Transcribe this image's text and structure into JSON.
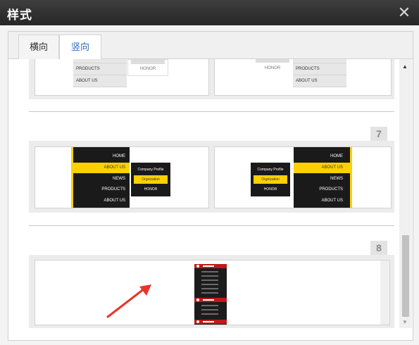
{
  "dialog": {
    "title": "样式",
    "close_icon": "close-icon"
  },
  "tabs": [
    {
      "label": "横向",
      "active": false
    },
    {
      "label": "竖向",
      "active": true
    }
  ],
  "sections": [
    {
      "number": "",
      "left_card": {
        "menu_items": [
          "PRODUCTS",
          "ABOUT US"
        ],
        "submenu_items": [
          "HONOR"
        ]
      },
      "right_card": {
        "menu_items": [
          "PRODUCTS",
          "ABOUT US"
        ],
        "submenu_items": [
          "HONOR"
        ]
      }
    },
    {
      "number": "7",
      "left_card": {
        "menu_items": [
          "HOME",
          "ABOUT US",
          "NEWS",
          "PRODUCTS",
          "ABOUT US"
        ],
        "active_index": 1,
        "submenu_items": [
          "Company Profile",
          "Orgnization",
          "HONOR"
        ],
        "submenu_active_index": 1
      },
      "right_card": {
        "menu_items": [
          "HOME",
          "ABOUT US",
          "NEWS",
          "PRODUCTS",
          "ABOUT US"
        ],
        "active_index": 1,
        "submenu_items": [
          "Company Profile",
          "Orgnization",
          "HONOR"
        ],
        "submenu_active_index": 1
      }
    },
    {
      "number": "8",
      "card": {
        "style": "red-black vertical menu"
      }
    }
  ],
  "colors": {
    "accent_yellow": "#ffd000",
    "menu_dark": "#1a1a1a",
    "menu_red": "#c11818",
    "annotation_arrow": "#e8352b",
    "active_tab_text": "#2b6cb8"
  }
}
